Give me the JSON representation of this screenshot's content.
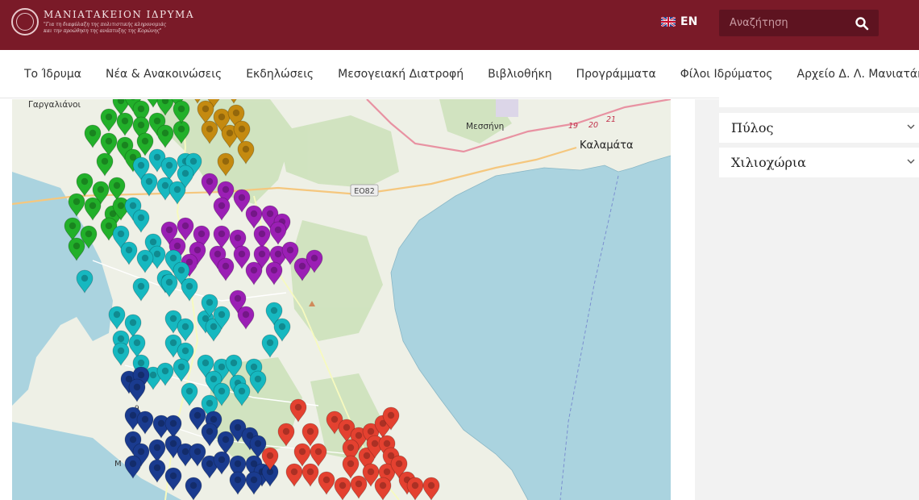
{
  "header": {
    "logo_name": "ΜΑΝΙΑΤΑΚΕΙΟΝ ΙΔΡΥΜΑ",
    "logo_tagline_1": "\"Για τη διαφύλαξη της πολιτιστικής κληρονομιάς",
    "logo_tagline_2": "και την προώθηση της ανάπτυξης της Κορώνης\"",
    "language_label": "EN",
    "search_placeholder": "Αναζήτηση",
    "brand_color": "#7a1a28"
  },
  "nav": {
    "items": [
      "Το Ίδρυμα",
      "Νέα & Ανακοινώσεις",
      "Εκδηλώσεις",
      "Μεσογειακή Διατροφή",
      "Βιβλιοθήκη",
      "Προγράμματα",
      "Φίλοι Ιδρύματος",
      "Αρχείο Δ. Λ. Μανιατάκη"
    ]
  },
  "map": {
    "labels": {
      "gargalianoi": "Γαργαλιάνοι",
      "messini": "Μεσσήνη",
      "kalamata": "Καλαμάτα",
      "eo82": "ΕΟ82",
      "eo": "ΕΟ",
      "road_19": "19",
      "road_20": "20",
      "road_21": "21",
      "m_label": "Μ",
      "road_9": "9"
    },
    "marker_colors": {
      "green": "#22b02a",
      "gold": "#c48a10",
      "purple": "#9b1fb5",
      "teal": "#16b8c0",
      "navy": "#1a3b8f",
      "red": "#e44130"
    }
  },
  "sidebar": {
    "items": [
      "Πύλος",
      "Χιλιοχώρια"
    ]
  }
}
